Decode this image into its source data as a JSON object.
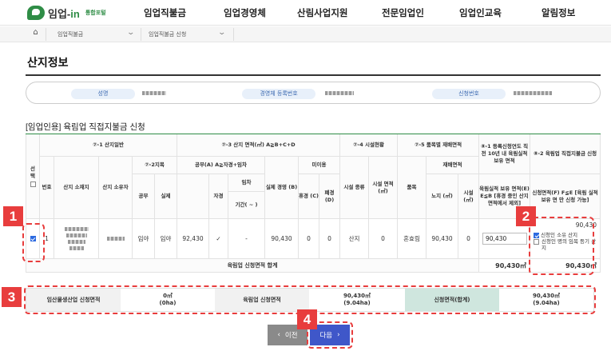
{
  "nav": {
    "logo_text_pre": "임업-",
    "logo_text_in": "in",
    "logo_sub": "통합포털",
    "menu": [
      "임업직불금",
      "임업경영체",
      "산림사업지원",
      "전문임업인",
      "임업인교육",
      "알림정보"
    ]
  },
  "breadcrumb": {
    "level1": "임업직불금",
    "level2": "임업직불금 신청"
  },
  "page_title": "산지정보",
  "info": {
    "name_label": "성명",
    "reg_label": "경영체 등록번호",
    "app_label": "신청번호"
  },
  "section_title": "[임업인용] 육림업 직접지불금 신청",
  "table": {
    "h_select": "선택",
    "h_no": "번호",
    "h_general": "⑦-1 산지일반",
    "h_location": "산지 소재지",
    "h_owner": "산지 소유자",
    "h_category": "⑦-2지목",
    "h_cat_official": "공부",
    "h_cat_actual": "실제",
    "h_area": "⑦-3 산지 면적(㎡) A≧B+C+D",
    "h_official_a": "공부(A) A≧자경+임차",
    "h_self": "자경",
    "h_lease": "임차",
    "h_period": "기간( ~ )",
    "h_actual_b": "실제 경영 (B)",
    "h_unused": "미이용",
    "h_rest_c": "휴경 (C)",
    "h_abandon_d": "폐경 (D)",
    "h_facility": "⑦-4 시설현황",
    "h_fac_type": "시설 종류",
    "h_fac_area": "시설 면적 (㎡)",
    "h_crop": "⑦-5 품목별 재배면적",
    "h_item": "품목",
    "h_cultivated": "재배면적",
    "h_openfield": "노지 (㎡)",
    "h_fac2": "시설 (㎡)",
    "h_81": "⑧-1 등록신청연도 직전 10년 내 육림실적 보유 면적",
    "h_81_sub": "육림실적 보유 면적(E) E≦B [휴경 중인 산지 면적에서 제외]",
    "h_82": "⑧-2 육림업 직접지불금 신청",
    "h_82_sub": "신청면적(F) F≦E [육림 실적 보유 면 만 신청 가능]",
    "row": {
      "no": "1",
      "cat_official": "임야",
      "cat_actual": "임야",
      "official_a": "92,430",
      "self": "✓",
      "lease": "-",
      "actual_b": "90,430",
      "rest_c": "0",
      "abandon_d": "0",
      "fac_type": "산지",
      "fac_area": "0",
      "item": "혼효림",
      "openfield": "90,430",
      "fac2": "0",
      "e_value": "90,430",
      "f_value": "90,430",
      "opt1": "신청인 소유 산지",
      "opt2": "신청인 명의 임목 등기 산지"
    },
    "total_label": "육림업 신청면적 합계",
    "total_e": "90,430㎡",
    "total_f": "90,430㎡"
  },
  "summary": {
    "l1": "임산물생산업 신청면적",
    "v1_a": "0㎡",
    "v1_b": "(0ha)",
    "l2": "육림업 신청면적",
    "v2_a": "90,430㎡",
    "v2_b": "(9.04ha)",
    "l3": "신청면적(합계)",
    "v3_a": "90,430㎡",
    "v3_b": "(9.04ha)"
  },
  "buttons": {
    "prev": "이전",
    "next": "다음"
  },
  "callouts": [
    "1",
    "2",
    "3",
    "4"
  ],
  "colors": {
    "accent_green": "#2f8d46",
    "callout_red": "#e83d3d",
    "next_blue": "#3f57c9",
    "prev_gray": "#8a8a8a"
  }
}
